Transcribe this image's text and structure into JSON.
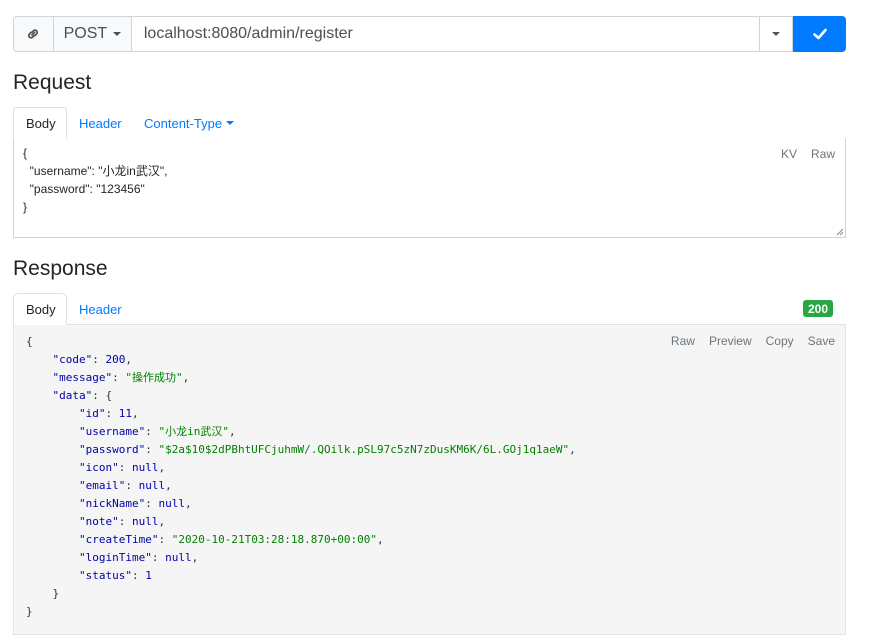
{
  "urlbar": {
    "method": "POST",
    "url": "localhost:8080/admin/register"
  },
  "request": {
    "heading": "Request",
    "tabs": [
      {
        "label": "Body",
        "active": true
      },
      {
        "label": "Header",
        "active": false
      },
      {
        "label": "Content-Type",
        "active": false
      }
    ],
    "body_lines": [
      "{",
      "  \"username\": \"小龙in武汉\",",
      "  \"password\": \"123456\"",
      "}"
    ],
    "actions": [
      "KV",
      "Raw"
    ]
  },
  "response": {
    "heading": "Response",
    "tabs": [
      {
        "label": "Body",
        "active": true
      },
      {
        "label": "Header",
        "active": false
      }
    ],
    "status": "200",
    "actions": [
      "Raw",
      "Preview",
      "Copy",
      "Save"
    ],
    "json": {
      "code": 200,
      "message": "操作成功",
      "data": {
        "id": 11,
        "username": "小龙in武汉",
        "password": "$2a$10$2dPBhtUFCjuhmW/.QOilk.pSL97c5zN7zDusKM6K/6L.GOj1q1aeW",
        "icon": null,
        "email": null,
        "nickName": null,
        "note": null,
        "createTime": "2020-10-21T03:28:18.870+00:00",
        "loginTime": null,
        "status": 1
      }
    }
  },
  "colors": {
    "primary": "#007bff",
    "success": "#28a745",
    "border": "#ced4da",
    "code_bg": "#f5f5f5",
    "string": "#008000",
    "keyword": "#0000aa"
  },
  "icons": {
    "link": "link-icon",
    "send": "check-icon",
    "dropdown": "caret-down-icon"
  }
}
